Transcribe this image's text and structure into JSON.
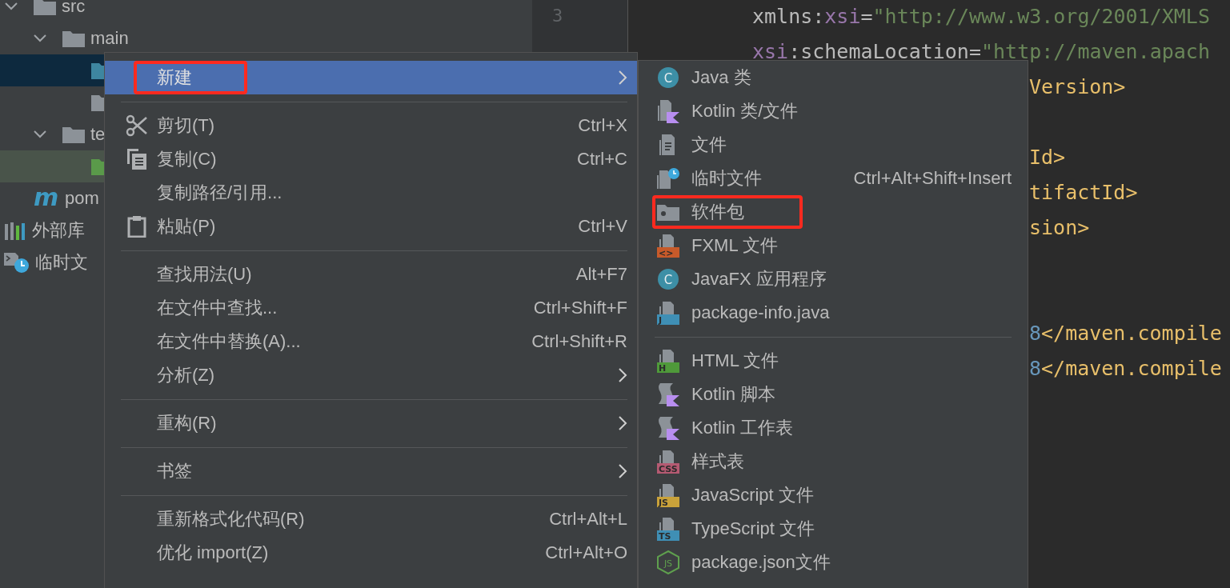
{
  "sidebar": {
    "module_items": [
      {
        "label": "src",
        "kind": "folder",
        "expanded": true,
        "selected": false,
        "children": [
          {
            "label": "main",
            "kind": "folder",
            "expanded": true,
            "selected": false,
            "children": [
              {
                "kind": "source-folder",
                "selected": true
              },
              {
                "kind": "folder",
                "selected": false
              }
            ]
          },
          {
            "label": "te",
            "kind": "folder",
            "expanded": true,
            "selected": false,
            "children": [
              {
                "kind": "test-folder",
                "selected": false
              }
            ]
          }
        ]
      },
      {
        "label": "pom",
        "kind": "maven",
        "badge": "m",
        "selected": false
      }
    ],
    "root_items": [
      {
        "label": "外部库",
        "kind": "library",
        "selected": false
      },
      {
        "label": "临时文",
        "kind": "scratch",
        "selected": false
      }
    ]
  },
  "editor": {
    "line_numbers": [
      "3"
    ],
    "lines": [
      {
        "kind": "full",
        "tokens": [
          {
            "text": "xmlns:",
            "kind": "attr"
          },
          {
            "text": "xsi",
            "kind": "ns"
          },
          {
            "text": "=",
            "kind": "attr"
          },
          {
            "text": "\"http://www.w3.org/2001/XMLS",
            "kind": "str"
          }
        ]
      },
      {
        "kind": "full",
        "tokens": [
          {
            "text": "xsi",
            "kind": "ns"
          },
          {
            "text": ":schemaLocation=",
            "kind": "attr"
          },
          {
            "text": "\"http://maven.apach",
            "kind": "str"
          }
        ]
      },
      {
        "kind": "clipped",
        "tokens": [
          {
            "text": "Version>",
            "kind": "tag"
          }
        ]
      },
      {
        "kind": "blank"
      },
      {
        "kind": "clipped",
        "tokens": [
          {
            "text": "Id>",
            "kind": "tag"
          }
        ]
      },
      {
        "kind": "clipped",
        "tokens": [
          {
            "text": "tifactId>",
            "kind": "tag"
          }
        ]
      },
      {
        "kind": "clipped",
        "tokens": [
          {
            "text": "sion>",
            "kind": "tag"
          }
        ]
      },
      {
        "kind": "blank"
      },
      {
        "kind": "blank"
      },
      {
        "kind": "clipped",
        "tokens": [
          {
            "text": "8",
            "kind": "num"
          },
          {
            "text": "</maven.compile",
            "kind": "tag"
          }
        ]
      },
      {
        "kind": "clipped",
        "tokens": [
          {
            "text": "8",
            "kind": "num"
          },
          {
            "text": "</maven.compile",
            "kind": "tag"
          }
        ]
      }
    ]
  },
  "context_menu": {
    "items": [
      {
        "kind": "plain",
        "label": "新建",
        "submenu": true,
        "selected": true,
        "highlighted": true
      },
      {
        "kind": "separator"
      },
      {
        "kind": "cut",
        "label": "剪切(T)",
        "shortcut": "Ctrl+X",
        "selected": false,
        "highlighted": false
      },
      {
        "kind": "copy",
        "label": "复制(C)",
        "shortcut": "Ctrl+C",
        "selected": false,
        "highlighted": false
      },
      {
        "kind": "plain",
        "label": "复制路径/引用...",
        "selected": false,
        "highlighted": false
      },
      {
        "kind": "paste",
        "label": "粘贴(P)",
        "shortcut": "Ctrl+V",
        "selected": false,
        "highlighted": false
      },
      {
        "kind": "separator"
      },
      {
        "kind": "plain",
        "label": "查找用法(U)",
        "shortcut": "Alt+F7",
        "selected": false,
        "highlighted": false
      },
      {
        "kind": "plain",
        "label": "在文件中查找...",
        "shortcut": "Ctrl+Shift+F",
        "selected": false,
        "highlighted": false
      },
      {
        "kind": "plain",
        "label": "在文件中替换(A)...",
        "shortcut": "Ctrl+Shift+R",
        "selected": false,
        "highlighted": false
      },
      {
        "kind": "plain",
        "label": "分析(Z)",
        "submenu": true,
        "selected": false,
        "highlighted": false
      },
      {
        "kind": "separator"
      },
      {
        "kind": "plain",
        "label": "重构(R)",
        "submenu": true,
        "selected": false,
        "highlighted": false
      },
      {
        "kind": "separator"
      },
      {
        "kind": "plain",
        "label": "书签",
        "submenu": true,
        "selected": false,
        "highlighted": false
      },
      {
        "kind": "separator"
      },
      {
        "kind": "plain",
        "label": "重新格式化代码(R)",
        "shortcut": "Ctrl+Alt+L",
        "selected": false,
        "highlighted": false
      },
      {
        "kind": "plain",
        "label": "优化 import(Z)",
        "shortcut": "Ctrl+Alt+O",
        "selected": false,
        "highlighted": false
      }
    ]
  },
  "new_submenu": {
    "items": [
      {
        "kind": "class",
        "badge": "C",
        "label": "Java 类",
        "selected": false,
        "highlighted": false
      },
      {
        "kind": "kotlin",
        "label": "Kotlin 类/文件",
        "selected": false,
        "highlighted": false
      },
      {
        "kind": "file",
        "label": "文件",
        "selected": false,
        "highlighted": false
      },
      {
        "kind": "scratch",
        "label": "临时文件",
        "shortcut": "Ctrl+Alt+Shift+Insert",
        "selected": false,
        "highlighted": false
      },
      {
        "kind": "package",
        "label": "软件包",
        "selected": false,
        "highlighted": true
      },
      {
        "kind": "typed",
        "badge": "<>",
        "color": "#c75a2a",
        "label": "FXML 文件",
        "selected": false,
        "highlighted": false
      },
      {
        "kind": "class",
        "badge": "C",
        "label": "JavaFX 应用程序",
        "selected": false,
        "highlighted": false
      },
      {
        "kind": "typed",
        "badge": "J",
        "color": "#3f8fb5",
        "label": "package-info.java",
        "selected": false,
        "highlighted": false
      },
      {
        "kind": "separator"
      },
      {
        "kind": "typed",
        "badge": "H",
        "color": "#4f9a3a",
        "label": "HTML 文件",
        "selected": false,
        "highlighted": false
      },
      {
        "kind": "script",
        "label": "Kotlin 脚本",
        "selected": false,
        "highlighted": false
      },
      {
        "kind": "script",
        "label": "Kotlin 工作表",
        "selected": false,
        "highlighted": false
      },
      {
        "kind": "typed",
        "badge": "CSS",
        "color": "#b55a72",
        "label": "样式表",
        "selected": false,
        "highlighted": false
      },
      {
        "kind": "typed",
        "badge": "JS",
        "color": "#c9a23a",
        "label": "JavaScript 文件",
        "selected": false,
        "highlighted": false
      },
      {
        "kind": "typed",
        "badge": "TS",
        "color": "#3f8fb5",
        "label": "TypeScript 文件",
        "selected": false,
        "highlighted": false
      },
      {
        "kind": "node",
        "badge": "JS",
        "label": "package.json文件",
        "selected": false,
        "highlighted": false
      }
    ]
  }
}
